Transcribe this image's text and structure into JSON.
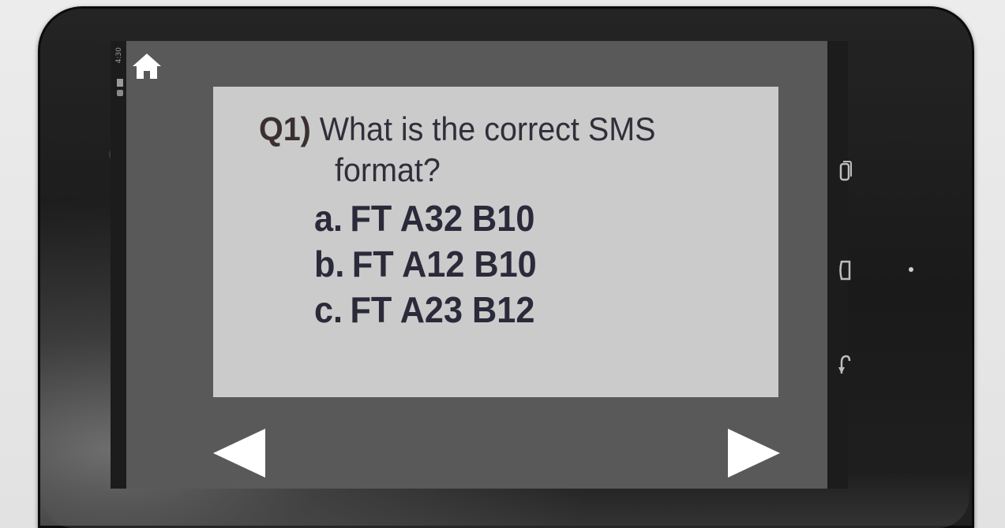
{
  "status_bar": {
    "time": "4:30"
  },
  "question": {
    "number": "Q1)",
    "text_line1": "What is the correct SMS",
    "text_line2": "format?",
    "options": [
      {
        "label": "a.",
        "text": "FT A32 B10"
      },
      {
        "label": "b.",
        "text": "FT A12 B10"
      },
      {
        "label": "c.",
        "text": "FT A23 B12"
      }
    ]
  },
  "navigation": {
    "prev_icon": "triangle-left-icon",
    "next_icon": "triangle-right-icon",
    "home_icon": "home-icon"
  },
  "system_buttons": [
    "recent-apps-icon",
    "home-button-icon",
    "back-icon"
  ],
  "colors": {
    "app_background": "#595959",
    "card_background": "#cbcbcb",
    "text": "#2f2f3a",
    "nav_arrow": "#ffffff"
  }
}
